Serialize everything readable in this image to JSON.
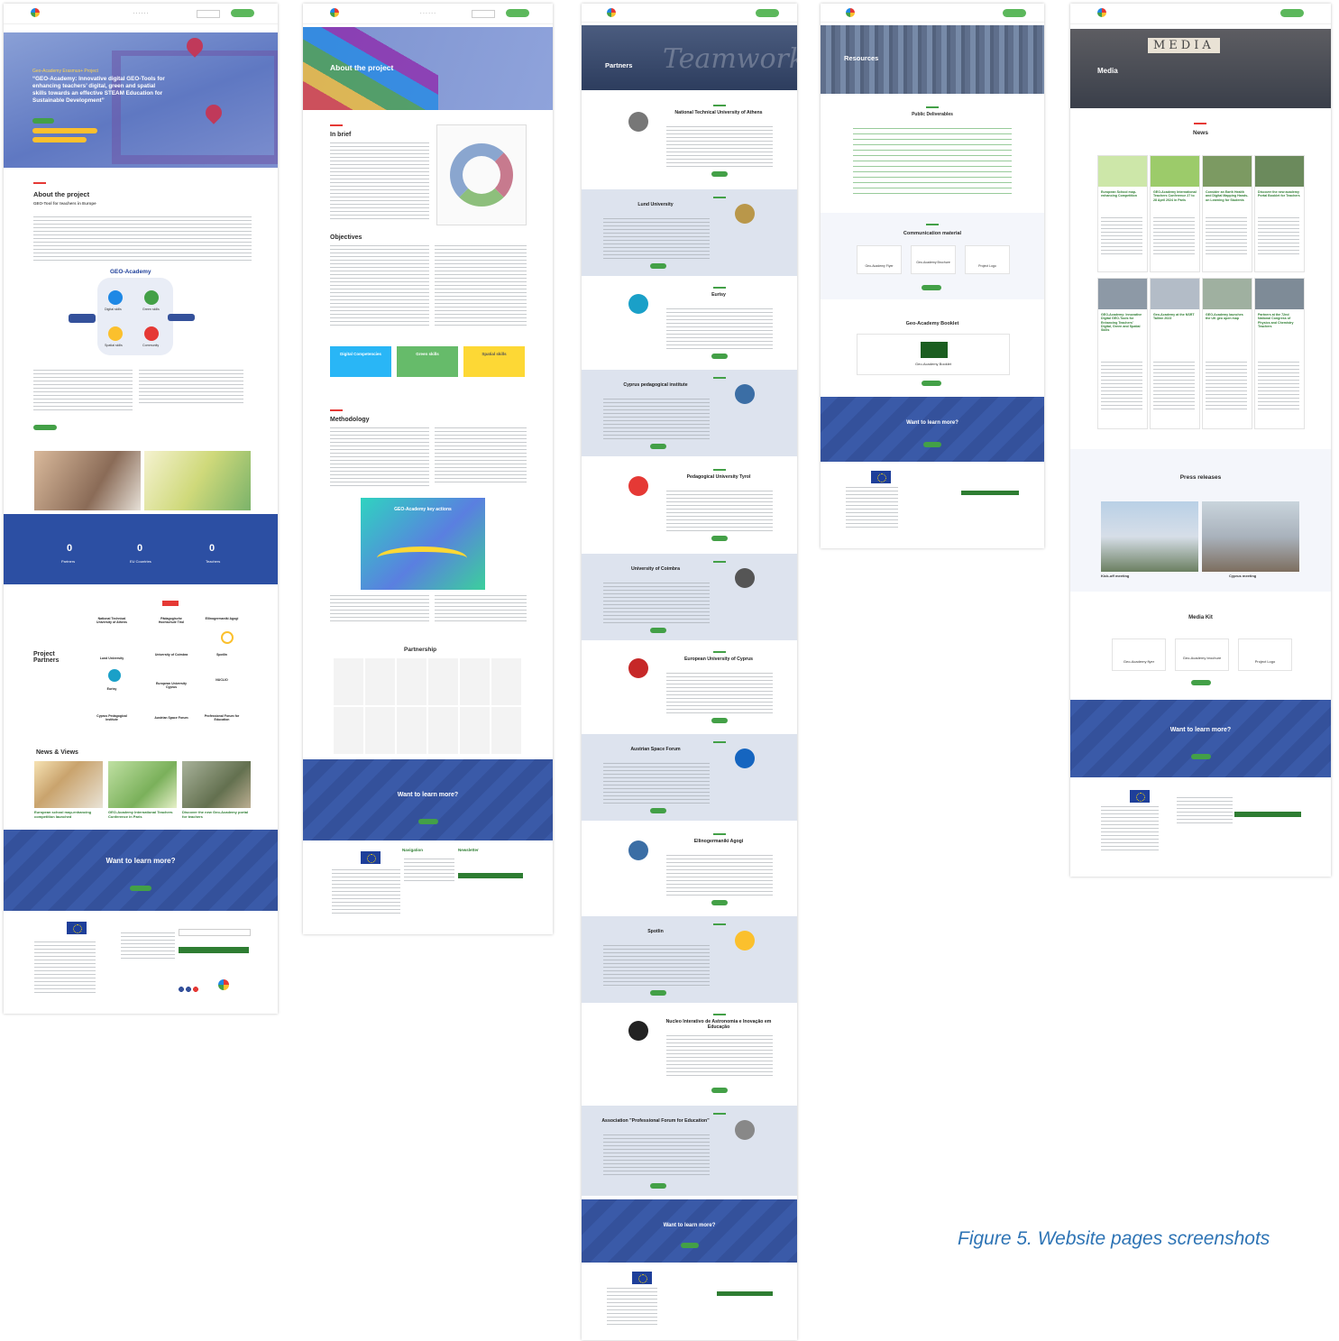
{
  "caption": "Figure 5. Website pages screenshots",
  "pages": {
    "home": {
      "hero_label": "Geo-Academy Erasmus+ Project",
      "hero_title": "“GEO-Academy: Innovative digital GEO-Tools for enhancing teachers’ digital, green and spatial skills towards an effective STEAM Education for Sustainable Development”",
      "about_title": "About the project",
      "about_subtitle": "GEO-Tool for teachers in Europe",
      "diagram_title": "GEO-Academy",
      "diagram_nodes": [
        "Digital skills",
        "Green skills",
        "Spatial skills",
        "Community"
      ],
      "counters": [
        {
          "value": "0",
          "label": "Partners"
        },
        {
          "value": "0",
          "label": "EU Countries"
        },
        {
          "value": "0",
          "label": "Teachers"
        }
      ],
      "partners_title": "Project Partners",
      "partners": [
        "National Technical University of Athens",
        "Pädagogische Hochschule Tirol",
        "Ellinogermaniki Agogi",
        "Lund University",
        "University of Coimbra",
        "Spotlin",
        "Eurisy",
        "European University Cyprus",
        "NUCLIO",
        "Cyprus Pedagogical Institute",
        "Austrian Space Forum",
        "Professional Forum for Education"
      ],
      "news_title": "News & Views",
      "news": [
        "European school map-enhancing competition launched",
        "GEO-Academy International Teachers Conference in Paris",
        "Discover the new Geo-Academy portal for teachers"
      ],
      "learn_more": "Want to learn more?"
    },
    "about": {
      "hero_title": "About the project",
      "brief_title": "In brief",
      "objectives_title": "Objectives",
      "boxes": [
        "Digital Competencies",
        "Green skills",
        "Spatial skills"
      ],
      "methodology_title": "Methodology",
      "journey_title": "GEO-Academy key actions",
      "partnership_title": "Partnership",
      "learn_more": "Want to learn more?",
      "footer_nav": "Navigation",
      "footer_newsletter": "Newsletter"
    },
    "partners": {
      "hero_title": "Partners",
      "entries": [
        "National Technical University of Athens",
        "Lund University",
        "Eurisy",
        "Cyprus pedagogical institute",
        "Pedagogical University Tyrol",
        "University of Coimbra",
        "European University of Cyprus",
        "Austrian Space Forum",
        "Ellinogermaniki Agogi",
        "Spotlin",
        "Nucleo Interativo de Astronomia e Inovação em Educação",
        "Association \"Professional Forum for Education\""
      ],
      "learn_more": "Want to learn more?"
    },
    "resources": {
      "hero_title": "Resources",
      "public_title": "Public Deliverables",
      "comm_title": "Communication material",
      "comm_items": [
        "Geo-Academy Flyer",
        "Geo-Academy Brochure",
        "Project Logo"
      ],
      "booklet_title": "Geo-Academy Booklet",
      "booklet_item": "Geo-Academy Booklet",
      "learn_more": "Want to learn more?"
    },
    "media": {
      "hero_title": "Media",
      "hero_banner": "MEDIA",
      "news_title": "News",
      "news_cards": [
        "European School map-enhancing Competition",
        "GEO-Academy International Teachers Conference 27 to 28 April 2024 in Paris",
        "Consider an Earth Health and Digital Mapping Hands-on Learning for Students",
        "Discover the new academy Portal Booklet for Teachers",
        "GEO-Academy: Innovative Digital GEO-Tools for Enhancing Teachers’ Digital, Green and Spatial Skills",
        "Geo-Academy at the NSRT Tallinn 2023",
        "GEO-Academy launches the UK geo open map",
        "Partners at the 72nd National Congress of Physics and Chemistry Teachers"
      ],
      "press_title": "Press releases",
      "press_items": [
        "Kick-off meeting",
        "Cyprus meeting"
      ],
      "kit_title": "Media Kit",
      "kit_items": [
        "Geo-Academy flyer",
        "Geo-Academy brochure",
        "Project Logo"
      ],
      "learn_more": "Want to learn more?"
    }
  },
  "colors": {
    "accent_red": "#e53935",
    "accent_green": "#43a047",
    "brand_blue": "#34519b",
    "caption_blue": "#2e74b5"
  }
}
